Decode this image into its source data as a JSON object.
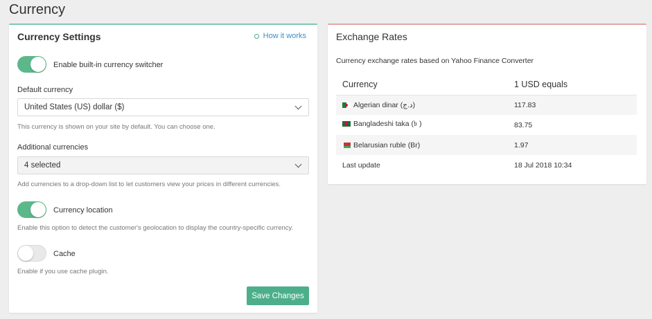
{
  "page": {
    "title": "Currency"
  },
  "settings": {
    "title": "Currency Settings",
    "how_link": "How it works",
    "enable_switcher": {
      "label": "Enable built-in currency switcher",
      "on": true
    },
    "default_currency": {
      "label": "Default currency",
      "value": "United States (US) dollar ($)",
      "help": "This currency is shown on your site by default. You can choose one."
    },
    "additional_currencies": {
      "label": "Additional currencies",
      "value": "4 selected",
      "help": "Add currencies to a drop-down list to let customers view your prices in different currencies."
    },
    "currency_location": {
      "label": "Currency location",
      "on": true,
      "help": "Enable this option to detect the customer's geolocation to display the country-specific currency."
    },
    "cache": {
      "label": "Cache",
      "on": false,
      "help": "Enable if you use cache plugin."
    },
    "save_label": "Save Changes"
  },
  "rates": {
    "title": "Exchange Rates",
    "description": "Currency exchange rates based on Yahoo Finance Converter",
    "headers": [
      "Currency",
      "1 USD equals"
    ],
    "rows": [
      {
        "flag": "algeria-flag-icon",
        "currency": "Algerian dinar (د.ج)",
        "value": "117.83"
      },
      {
        "flag": "bangladesh-flag-icon",
        "currency": "Bangladeshi taka (৳ )",
        "value": "83.75"
      },
      {
        "flag": "belarus-flag-icon",
        "currency": "Belarusian ruble (Br)",
        "value": "1.97"
      }
    ],
    "last_update": {
      "label": "Last update",
      "value": "18 Jul 2018 10:34"
    }
  },
  "colors": {
    "accent_green": "#4caf8a",
    "link_blue": "#3b8ec8",
    "left_card_border": "#7fc7b8",
    "right_card_border": "#e4a5a5"
  }
}
